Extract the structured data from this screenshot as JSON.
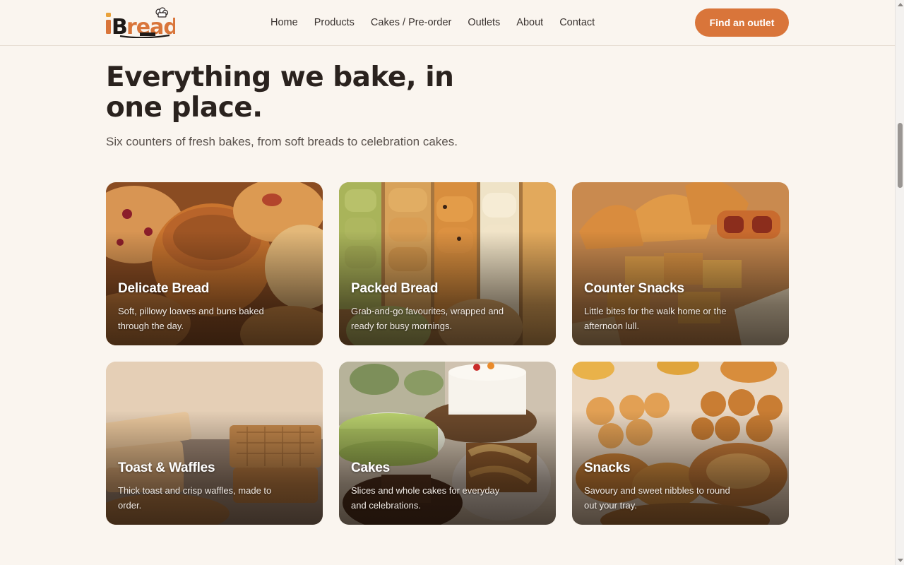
{
  "header": {
    "logo_text": "iBread",
    "nav": [
      {
        "label": "Home"
      },
      {
        "label": "Products"
      },
      {
        "label": "Cakes / Pre-order"
      },
      {
        "label": "Outlets"
      },
      {
        "label": "About"
      },
      {
        "label": "Contact"
      }
    ],
    "cta_label": "Find an outlet"
  },
  "hero": {
    "title": "Everything we bake, in one place.",
    "subtitle": "Six counters of fresh bakes, from soft breads to celebration cakes."
  },
  "categories": [
    {
      "title": "Delicate Bread",
      "description": "Soft, pillowy loaves and buns baked through the day."
    },
    {
      "title": "Packed Bread",
      "description": "Grab-and-go favourites, wrapped and ready for busy mornings."
    },
    {
      "title": "Counter Snacks",
      "description": "Little bites for the walk home or the afternoon lull."
    },
    {
      "title": "Toast & Waffles",
      "description": "Thick toast and crisp waffles, made to order."
    },
    {
      "title": "Cakes",
      "description": "Slices and whole cakes for everyday and celebrations."
    },
    {
      "title": "Snacks",
      "description": "Savoury and sweet nibbles to round out your tray."
    }
  ],
  "colors": {
    "page_background": "#faf5ef",
    "accent": "#d9753a",
    "heading": "#2a221e",
    "body_text": "#5a524d"
  },
  "icons": {
    "logo": "ibread-logo-with-chef-hat"
  }
}
